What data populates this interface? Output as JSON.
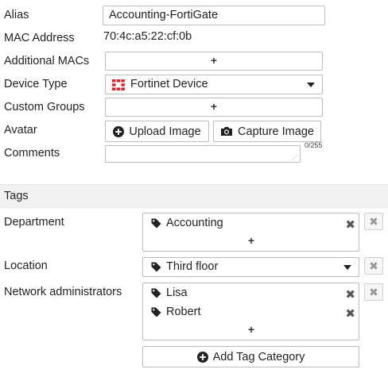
{
  "form": {
    "alias_label": "Alias",
    "alias_value": "Accounting-FortiGate",
    "mac_label": "MAC Address",
    "mac_value": "70:4c:a5:22:cf:0b",
    "additional_macs_label": "Additional MACs",
    "device_type_label": "Device Type",
    "device_type_value": "Fortinet Device",
    "custom_groups_label": "Custom Groups",
    "avatar_label": "Avatar",
    "upload_image_label": "Upload Image",
    "capture_image_label": "Capture Image",
    "comments_label": "Comments",
    "comments_counter": "0/255",
    "add_symbol": "+"
  },
  "tags": {
    "section_title": "Tags",
    "department": {
      "label": "Department",
      "values": [
        "Accounting"
      ]
    },
    "location": {
      "label": "Location",
      "value": "Third floor"
    },
    "network_admins": {
      "label": "Network administrators",
      "values": [
        "Lisa",
        "Robert"
      ]
    },
    "add_category_label": "Add Tag Category",
    "remove_symbol": "✖",
    "close_symbol": "✖"
  },
  "icons": {
    "tag": "tag-icon",
    "fortinet": "fortinet-logo-icon",
    "plus_circle": "plus-circle-icon",
    "camera": "camera-icon"
  },
  "colors": {
    "fortinet_red": "#e01f27",
    "section_bg": "#f2f2f2",
    "border": "#bcbcbc"
  }
}
